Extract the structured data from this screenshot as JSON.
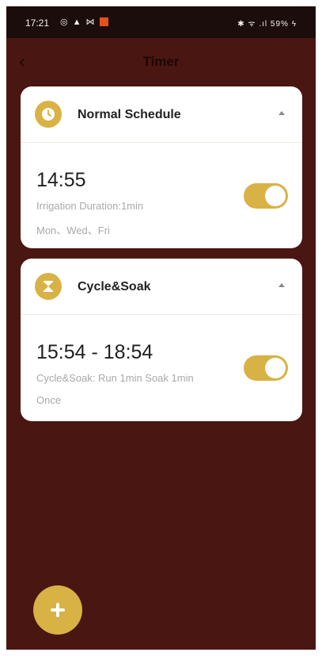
{
  "status_bar": {
    "time": "17:21",
    "status_right": "✱ ᯤ .ıl 59% ϟ"
  },
  "header": {
    "title": "Timer"
  },
  "schedules": [
    {
      "title": "Normal Schedule",
      "icon": "clock-icon",
      "time": "14:55",
      "detail": "Irrigation Duration:1min",
      "days": "Mon、Wed、Fri",
      "enabled": true
    },
    {
      "title": "Cycle&Soak",
      "icon": "hourglass-icon",
      "time": "15:54 - 18:54",
      "detail": "Cycle&Soak: Run 1min Soak 1min",
      "days": "Once",
      "enabled": true
    }
  ],
  "colors": {
    "background": "#4a1612",
    "accent": "#d8b245",
    "card": "#ffffff"
  }
}
